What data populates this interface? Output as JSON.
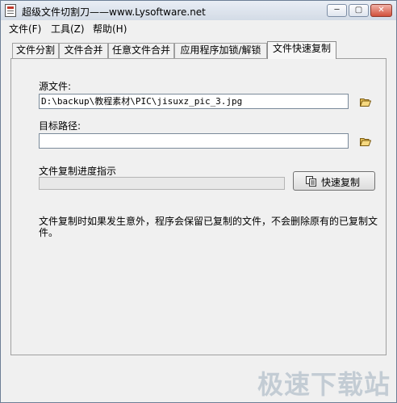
{
  "window": {
    "title": "超级文件切割刀——www.Lysoftware.net",
    "controls": {
      "minimize": "─",
      "maximize": "▢",
      "close": "✕"
    }
  },
  "menu": {
    "items": [
      {
        "label": "文件(F)"
      },
      {
        "label": "工具(Z)"
      },
      {
        "label": "帮助(H)"
      }
    ]
  },
  "tabs": [
    {
      "label": "文件分割",
      "active": false
    },
    {
      "label": "文件合并",
      "active": false
    },
    {
      "label": "任意文件合并",
      "active": false
    },
    {
      "label": "应用程序加锁/解锁",
      "active": false
    },
    {
      "label": "文件快速复制",
      "active": true
    }
  ],
  "copy_panel": {
    "source_label": "源文件:",
    "source_value": "D:\\backup\\教程素材\\PIC\\jisuxz_pic_3.jpg",
    "target_label": "目标路径:",
    "target_value": "",
    "progress_label": "文件复制进度指示",
    "progress_fraction": 0,
    "copy_button": "快速复制",
    "note": "文件复制时如果发生意外，程序会保留已复制的文件，不会删除原有的已复制文件。"
  },
  "icons": {
    "browse_source": "folder-open-icon",
    "browse_target": "folder-open-icon",
    "copy": "copy-icon"
  },
  "watermark": "极速下载站",
  "colors": {
    "progress": "#37b34a",
    "close_button": "#d1503b"
  }
}
